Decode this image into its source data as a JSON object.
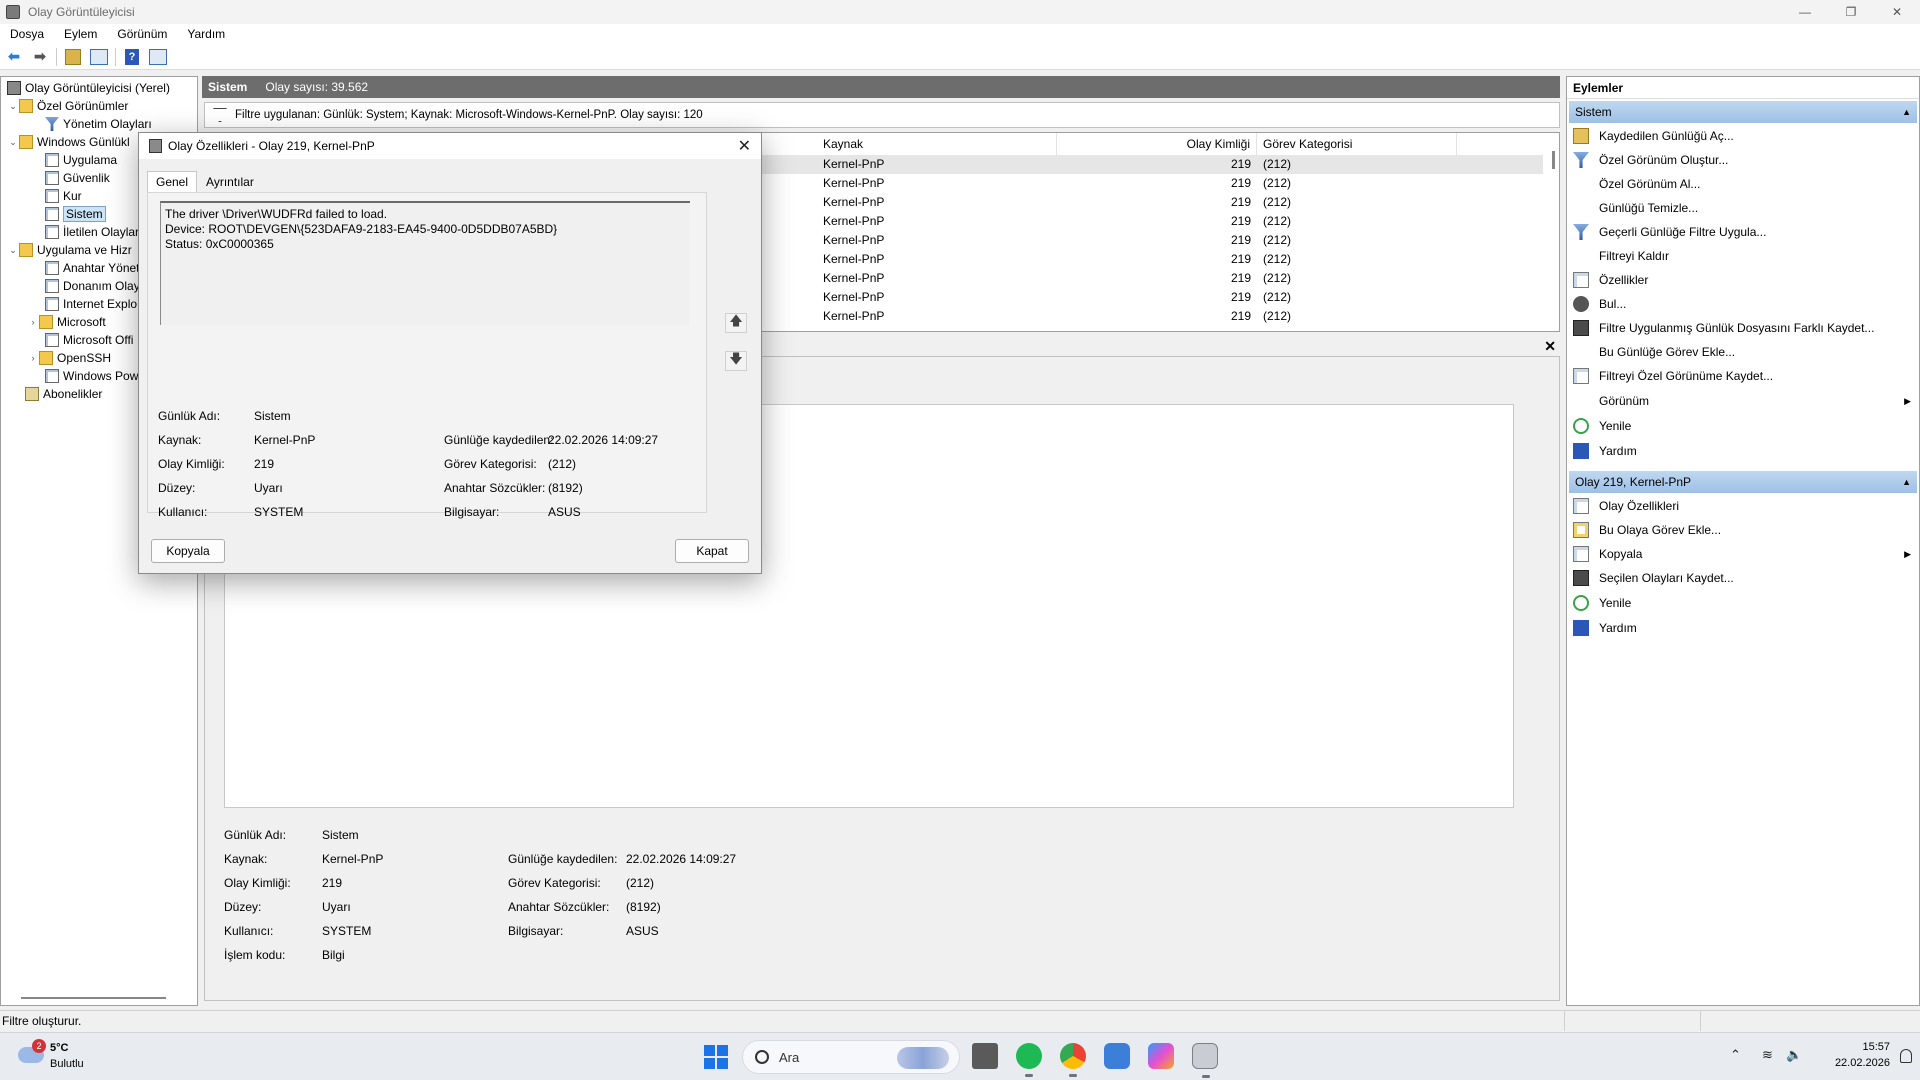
{
  "window": {
    "title": "Olay Görüntüleyicisi",
    "controls": [
      "—",
      "❐",
      "✕"
    ]
  },
  "menu": [
    "Dosya",
    "Eylem",
    "Görünüm",
    "Yardım"
  ],
  "tree": {
    "items": [
      {
        "label": "Olay Görüntüleyicisi (Yerel)",
        "icon": "viewer"
      },
      {
        "label": "Özel Görünümler",
        "icon": "folder",
        "exp": "⌄"
      },
      {
        "label": "Yönetim Olayları",
        "icon": "filter"
      },
      {
        "label": "Windows Günlükl",
        "icon": "folder",
        "exp": "⌄"
      },
      {
        "label": "Uygulama",
        "icon": "log"
      },
      {
        "label": "Güvenlik",
        "icon": "log"
      },
      {
        "label": "Kur",
        "icon": "log"
      },
      {
        "label": "Sistem",
        "icon": "log",
        "selected": true
      },
      {
        "label": "İletilen Olaylar",
        "icon": "log"
      },
      {
        "label": "Uygulama ve Hizr",
        "icon": "folder",
        "exp": "⌄"
      },
      {
        "label": "Anahtar Yönet",
        "icon": "log"
      },
      {
        "label": "Donanım Olay",
        "icon": "log"
      },
      {
        "label": "Internet Explo",
        "icon": "log"
      },
      {
        "label": "Microsoft",
        "icon": "folder",
        "exp": "›"
      },
      {
        "label": "Microsoft Offi",
        "icon": "log"
      },
      {
        "label": "OpenSSH",
        "icon": "folder",
        "exp": "›"
      },
      {
        "label": "Windows Pow",
        "icon": "log"
      },
      {
        "label": "Abonelikler",
        "icon": "sub"
      }
    ]
  },
  "center": {
    "log_name": "Sistem",
    "event_count": "Olay sayısı: 39.562",
    "filter_text": "Filtre uygulanan: Günlük: System; Kaynak: Microsoft-Windows-Kernel-PnP. Olay sayısı: 120",
    "columns": {
      "source": "Kaynak",
      "event_id": "Olay Kimliği",
      "task_category": "Görev Kategorisi"
    },
    "rows": [
      {
        "source": "Kernel-PnP",
        "event_id": "219",
        "task": "(212)"
      },
      {
        "source": "Kernel-PnP",
        "event_id": "219",
        "task": "(212)"
      },
      {
        "source": "Kernel-PnP",
        "event_id": "219",
        "task": "(212)"
      },
      {
        "source": "Kernel-PnP",
        "event_id": "219",
        "task": "(212)"
      },
      {
        "source": "Kernel-PnP",
        "event_id": "219",
        "task": "(212)"
      },
      {
        "source": "Kernel-PnP",
        "event_id": "219",
        "task": "(212)"
      },
      {
        "source": "Kernel-PnP",
        "event_id": "219",
        "task": "(212)"
      },
      {
        "source": "Kernel-PnP",
        "event_id": "219",
        "task": "(212)"
      },
      {
        "source": "Kernel-PnP",
        "event_id": "219",
        "task": "(212)"
      }
    ],
    "close_glyph": "✕"
  },
  "props": {
    "log_name_label": "Günlük Adı:",
    "log_name": "Sistem",
    "source_label": "Kaynak:",
    "source": "Kernel-PnP",
    "event_id_label": "Olay Kimliği:",
    "event_id": "219",
    "level_label": "Düzey:",
    "level": "Uyarı",
    "user_label": "Kullanıcı:",
    "user": "SYSTEM",
    "opcode_label": "İşlem kodu:",
    "opcode": "Bilgi",
    "logged_label": "Günlüğe kaydedilen:",
    "logged": "22.02.2026 14:09:27",
    "task_label": "Görev Kategorisi:",
    "task": "(212)",
    "keywords_label": "Anahtar Sözcükler:",
    "keywords": "(8192)",
    "computer_label": "Bilgisayar:",
    "computer": "ASUS"
  },
  "dialog": {
    "title": "Olay Özellikleri - Olay 219, Kernel-PnP",
    "tabs": [
      "Genel",
      "Ayrıntılar"
    ],
    "message": [
      "The driver \\Driver\\WUDFRd failed to load.",
      "Device: ROOT\\DEVGEN\\{523DAFA9-2183-EA45-9400-0D5DDB07A5BD}",
      "Status: 0xC0000365"
    ],
    "copy_button": "Kopyala",
    "close_button": "Kapat",
    "up_glyph": "🡅",
    "down_glyph": "🡇"
  },
  "actions": {
    "title": "Eylemler",
    "section1": "Sistem",
    "items1": [
      {
        "label": "Kaydedilen Günlüğü Aç...",
        "icon": "open"
      },
      {
        "label": "Özel Görünüm Oluştur...",
        "icon": "filter"
      },
      {
        "label": "Özel Görünüm Al...",
        "icon": "none"
      },
      {
        "label": "Günlüğü Temizle...",
        "icon": "none"
      },
      {
        "label": "Geçerli Günlüğe Filtre Uygula...",
        "icon": "filter"
      },
      {
        "label": "Filtreyi Kaldır",
        "icon": "none"
      },
      {
        "label": "Özellikler",
        "icon": "props"
      },
      {
        "label": "Bul...",
        "icon": "find"
      },
      {
        "label": "Filtre Uygulanmış Günlük Dosyasını Farklı Kaydet...",
        "icon": "save"
      },
      {
        "label": "Bu Günlüğe Görev Ekle...",
        "icon": "none"
      },
      {
        "label": "Filtreyi Özel Görünüme Kaydet...",
        "icon": "props"
      },
      {
        "label": "Görünüm",
        "icon": "none",
        "submenu": true
      },
      {
        "label": "Yenile",
        "icon": "refresh"
      },
      {
        "label": "Yardım",
        "icon": "help"
      }
    ],
    "section2": "Olay 219, Kernel-PnP",
    "items2": [
      {
        "label": "Olay Özellikleri",
        "icon": "props"
      },
      {
        "label": "Bu Olaya Görev Ekle...",
        "icon": "task"
      },
      {
        "label": "Kopyala",
        "icon": "props",
        "submenu": true
      },
      {
        "label": "Seçilen Olayları Kaydet...",
        "icon": "save"
      },
      {
        "label": "Yenile",
        "icon": "refresh"
      },
      {
        "label": "Yardım",
        "icon": "help"
      }
    ]
  },
  "status": "Filtre oluşturur.",
  "taskbar": {
    "weather_badge": "2",
    "temp": "5°C",
    "condition": "Bulutlu",
    "search_placeholder": "Ara",
    "time": "15:57",
    "date": "22.02.2026"
  }
}
